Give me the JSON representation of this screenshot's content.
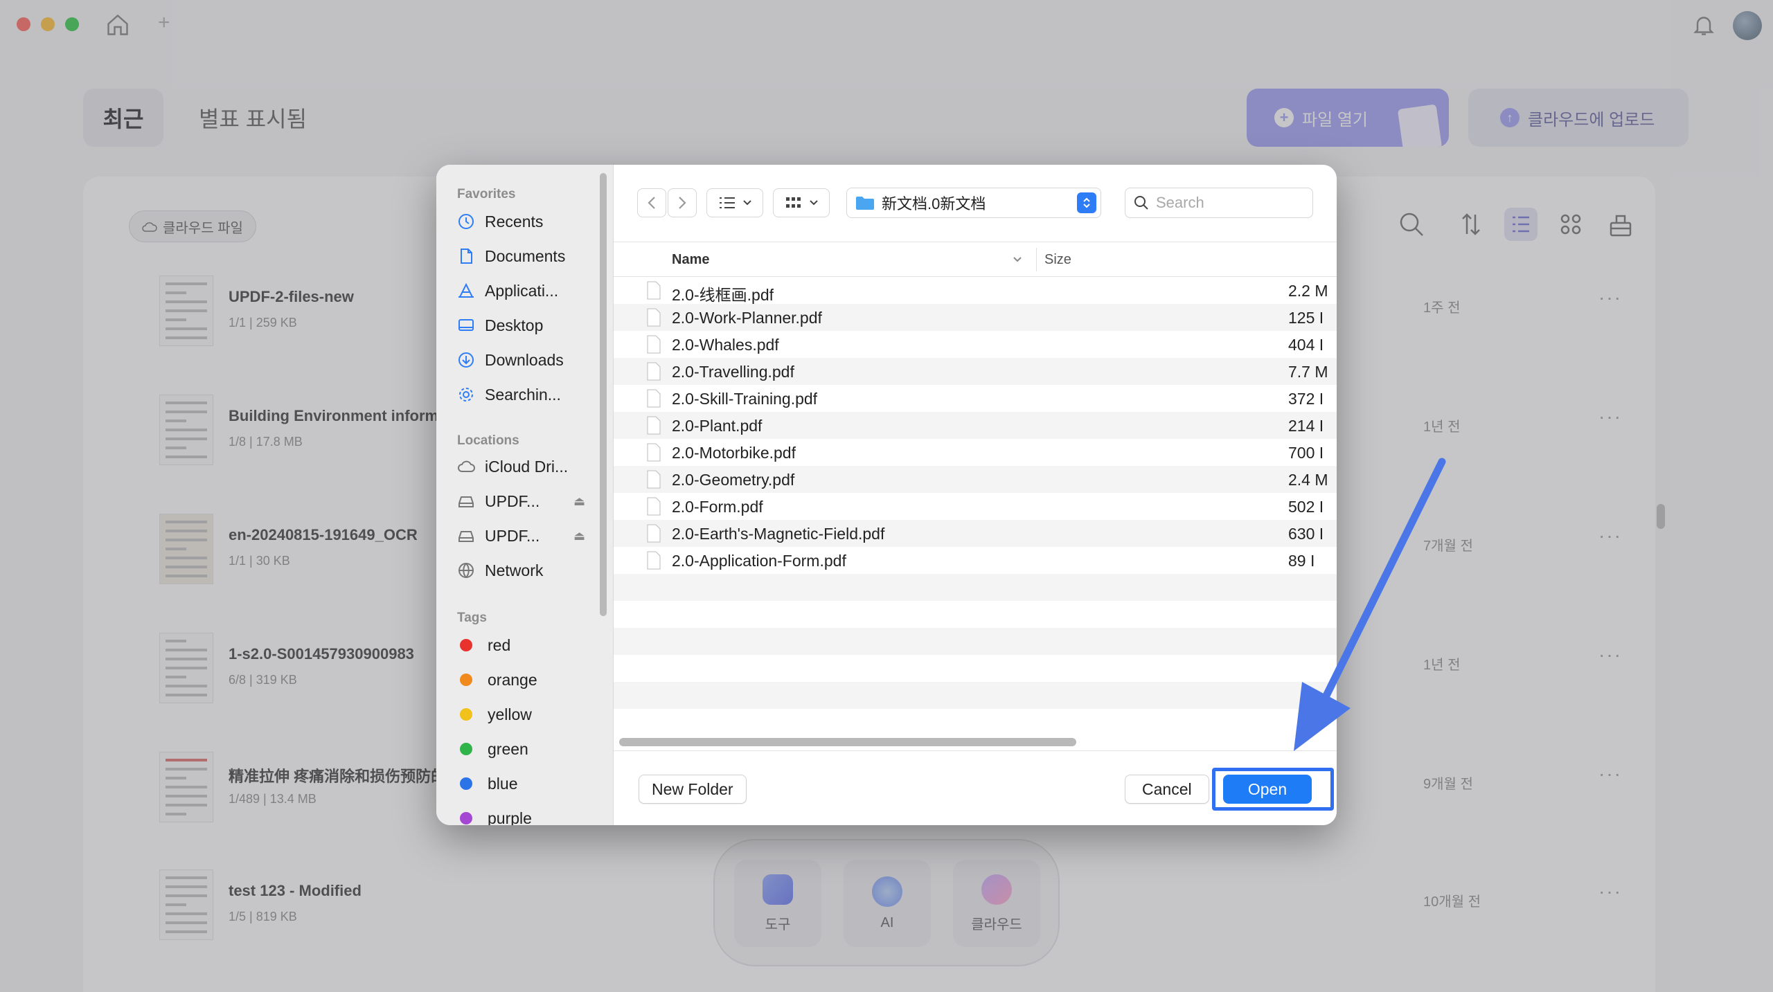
{
  "app": {
    "tabs": {
      "recent": "최근",
      "starred": "별표 표시됨"
    },
    "buttons": {
      "open_file": "파일 열기",
      "cloud_upload": "클라우드에 업로드",
      "cloud_files": "클라우드 파일"
    },
    "files": [
      {
        "title": "UPDF-2-files-new",
        "pages": "1/1",
        "size": "259 KB",
        "time": "1주 전"
      },
      {
        "title": "Building Environment informa",
        "pages": "1/8",
        "size": "17.8 MB",
        "time": "1년 전"
      },
      {
        "title": "en-20240815-191649_OCR",
        "pages": "1/1",
        "size": "30 KB",
        "time": "7개월 전"
      },
      {
        "title": "1-s2.0-S001457930900983",
        "pages": "6/8",
        "size": "319 KB",
        "time": "1년 전"
      },
      {
        "title": "精准拉伸 疼痛消除和损伤预防的",
        "pages": "1/489",
        "size": "13.4 MB",
        "time": "9개월 전"
      },
      {
        "title": "test 123 - Modified",
        "pages": "1/5",
        "size": "819 KB",
        "time": "10개월 전"
      }
    ],
    "dock": {
      "tools": "도구",
      "ai": "AI",
      "cloud": "클라우드"
    },
    "more_glyph": "···"
  },
  "dialog": {
    "sidebar": {
      "favorites_header": "Favorites",
      "favorites": [
        "Recents",
        "Documents",
        "Applicati...",
        "Desktop",
        "Downloads",
        "Searchin..."
      ],
      "locations_header": "Locations",
      "locations": [
        "iCloud Dri...",
        "UPDF...",
        "UPDF...",
        "Network"
      ],
      "tags_header": "Tags",
      "tags": [
        {
          "name": "red",
          "color": "#e8322d"
        },
        {
          "name": "orange",
          "color": "#f08a1d"
        },
        {
          "name": "yellow",
          "color": "#f1c21b"
        },
        {
          "name": "green",
          "color": "#30b44a"
        },
        {
          "name": "blue",
          "color": "#2a74e8"
        },
        {
          "name": "purple",
          "color": "#a448d4"
        }
      ]
    },
    "path": "新文档.0新文档",
    "search_placeholder": "Search",
    "columns": {
      "name": "Name",
      "size": "Size"
    },
    "files": [
      {
        "name": "2.0-线框画.pdf",
        "size": "2.2 M"
      },
      {
        "name": "2.0-Work-Planner.pdf",
        "size": "125 I"
      },
      {
        "name": "2.0-Whales.pdf",
        "size": "404 I"
      },
      {
        "name": "2.0-Travelling.pdf",
        "size": "7.7 M"
      },
      {
        "name": "2.0-Skill-Training.pdf",
        "size": "372 I"
      },
      {
        "name": "2.0-Plant.pdf",
        "size": "214 I"
      },
      {
        "name": "2.0-Motorbike.pdf",
        "size": "700 I"
      },
      {
        "name": "2.0-Geometry.pdf",
        "size": "2.4 M"
      },
      {
        "name": "2.0-Form.pdf",
        "size": "502 I"
      },
      {
        "name": "2.0-Earth's-Magnetic-Field.pdf",
        "size": "630 I"
      },
      {
        "name": "2.0-Application-Form.pdf",
        "size": "89 I"
      }
    ],
    "buttons": {
      "new_folder": "New Folder",
      "cancel": "Cancel",
      "open": "Open"
    },
    "colors": {
      "accent": "#1f7cf7",
      "highlight": "#2f6ff0"
    }
  }
}
